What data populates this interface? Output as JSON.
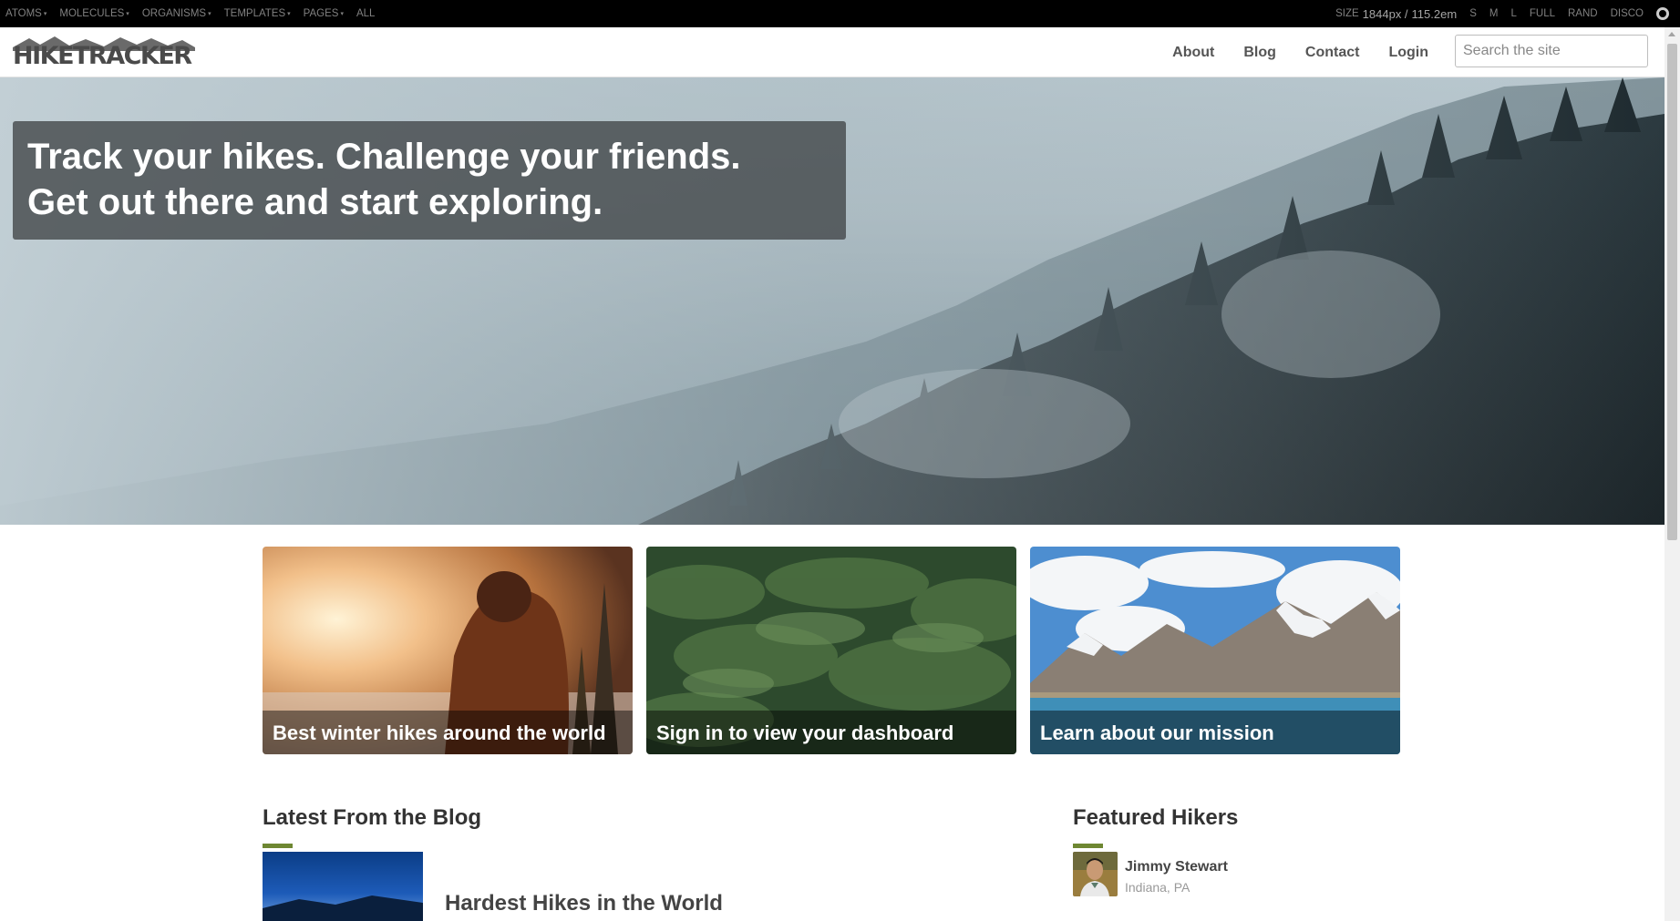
{
  "toolbar": {
    "menus": [
      {
        "label": "ATOMS",
        "caret": "▾"
      },
      {
        "label": "MOLECULES",
        "caret": "▾"
      },
      {
        "label": "ORGANISMS",
        "caret": "▾"
      },
      {
        "label": "TEMPLATES",
        "caret": "▾"
      },
      {
        "label": "PAGES",
        "caret": "▾"
      },
      {
        "label": "ALL",
        "caret": ""
      }
    ],
    "size_label": "SIZE",
    "size_px": "1844px /",
    "size_em": "115.2em",
    "sizes": [
      "S",
      "M",
      "L",
      "FULL",
      "RAND",
      "DISCO"
    ]
  },
  "header": {
    "logo": "HIKETRACKER",
    "nav": [
      "About",
      "Blog",
      "Contact",
      "Login"
    ],
    "search_placeholder": "Search the site"
  },
  "hero": {
    "line1": "Track your hikes. Challenge your friends.",
    "line2": "Get out there and start exploring."
  },
  "promos": [
    {
      "caption": "Best winter hikes around the world"
    },
    {
      "caption": "Sign in to view your dashboard"
    },
    {
      "caption": "Learn about our mission"
    }
  ],
  "blog": {
    "title": "Latest From the Blog",
    "post_title": "Hardest Hikes in the World"
  },
  "hikers": {
    "title": "Featured Hikers",
    "items": [
      {
        "name": "Jimmy Stewart",
        "location": "Indiana, PA"
      }
    ]
  },
  "colors": {
    "accent": "#6e8732",
    "toolbar_bg": "#000000"
  }
}
